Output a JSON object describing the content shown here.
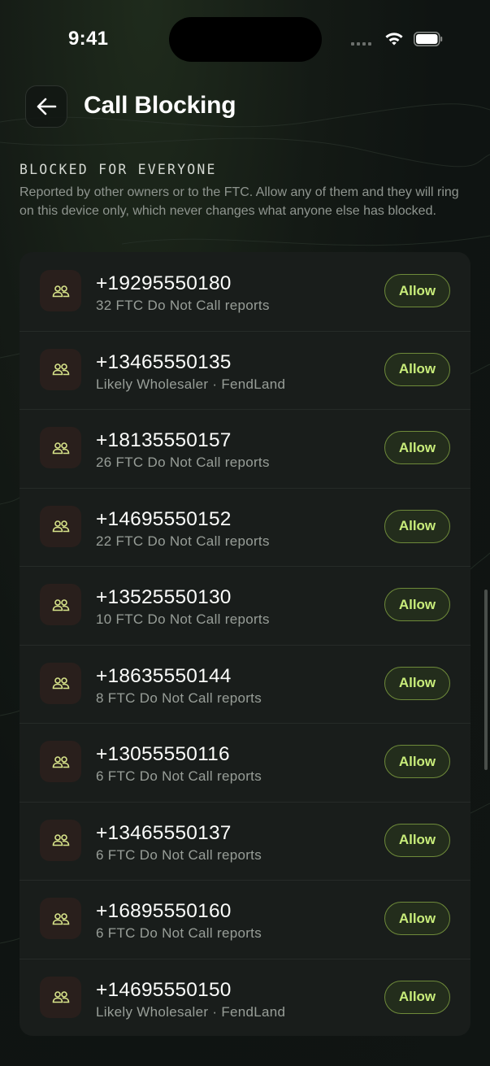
{
  "status_bar": {
    "time": "9:41"
  },
  "header": {
    "title": "Call Blocking",
    "back_icon": "arrow-left-icon"
  },
  "section": {
    "title": "BLOCKED FOR EVERYONE",
    "description": "Reported by other owners or to the FTC. Allow any of them and they will ring on this device only, which never changes what anyone else has blocked."
  },
  "colors": {
    "accent": "#c8ec7a",
    "background": "#121714",
    "card": "#191d1b",
    "avatar_bg": "#291f1c"
  },
  "items": [
    {
      "number": "+19295550180",
      "detail": "32 FTC Do Not Call reports",
      "action": "Allow",
      "icon": "people-icon"
    },
    {
      "number": "+13465550135",
      "detail": "Likely Wholesaler · FendLand",
      "action": "Allow",
      "icon": "people-icon"
    },
    {
      "number": "+18135550157",
      "detail": "26 FTC Do Not Call reports",
      "action": "Allow",
      "icon": "people-icon"
    },
    {
      "number": "+14695550152",
      "detail": "22 FTC Do Not Call reports",
      "action": "Allow",
      "icon": "people-icon"
    },
    {
      "number": "+13525550130",
      "detail": "10 FTC Do Not Call reports",
      "action": "Allow",
      "icon": "people-icon"
    },
    {
      "number": "+18635550144",
      "detail": "8 FTC Do Not Call reports",
      "action": "Allow",
      "icon": "people-icon"
    },
    {
      "number": "+13055550116",
      "detail": "6 FTC Do Not Call reports",
      "action": "Allow",
      "icon": "people-icon"
    },
    {
      "number": "+13465550137",
      "detail": "6 FTC Do Not Call reports",
      "action": "Allow",
      "icon": "people-icon"
    },
    {
      "number": "+16895550160",
      "detail": "6 FTC Do Not Call reports",
      "action": "Allow",
      "icon": "people-icon"
    },
    {
      "number": "+14695550150",
      "detail": "Likely Wholesaler · FendLand",
      "action": "Allow",
      "icon": "people-icon"
    }
  ]
}
